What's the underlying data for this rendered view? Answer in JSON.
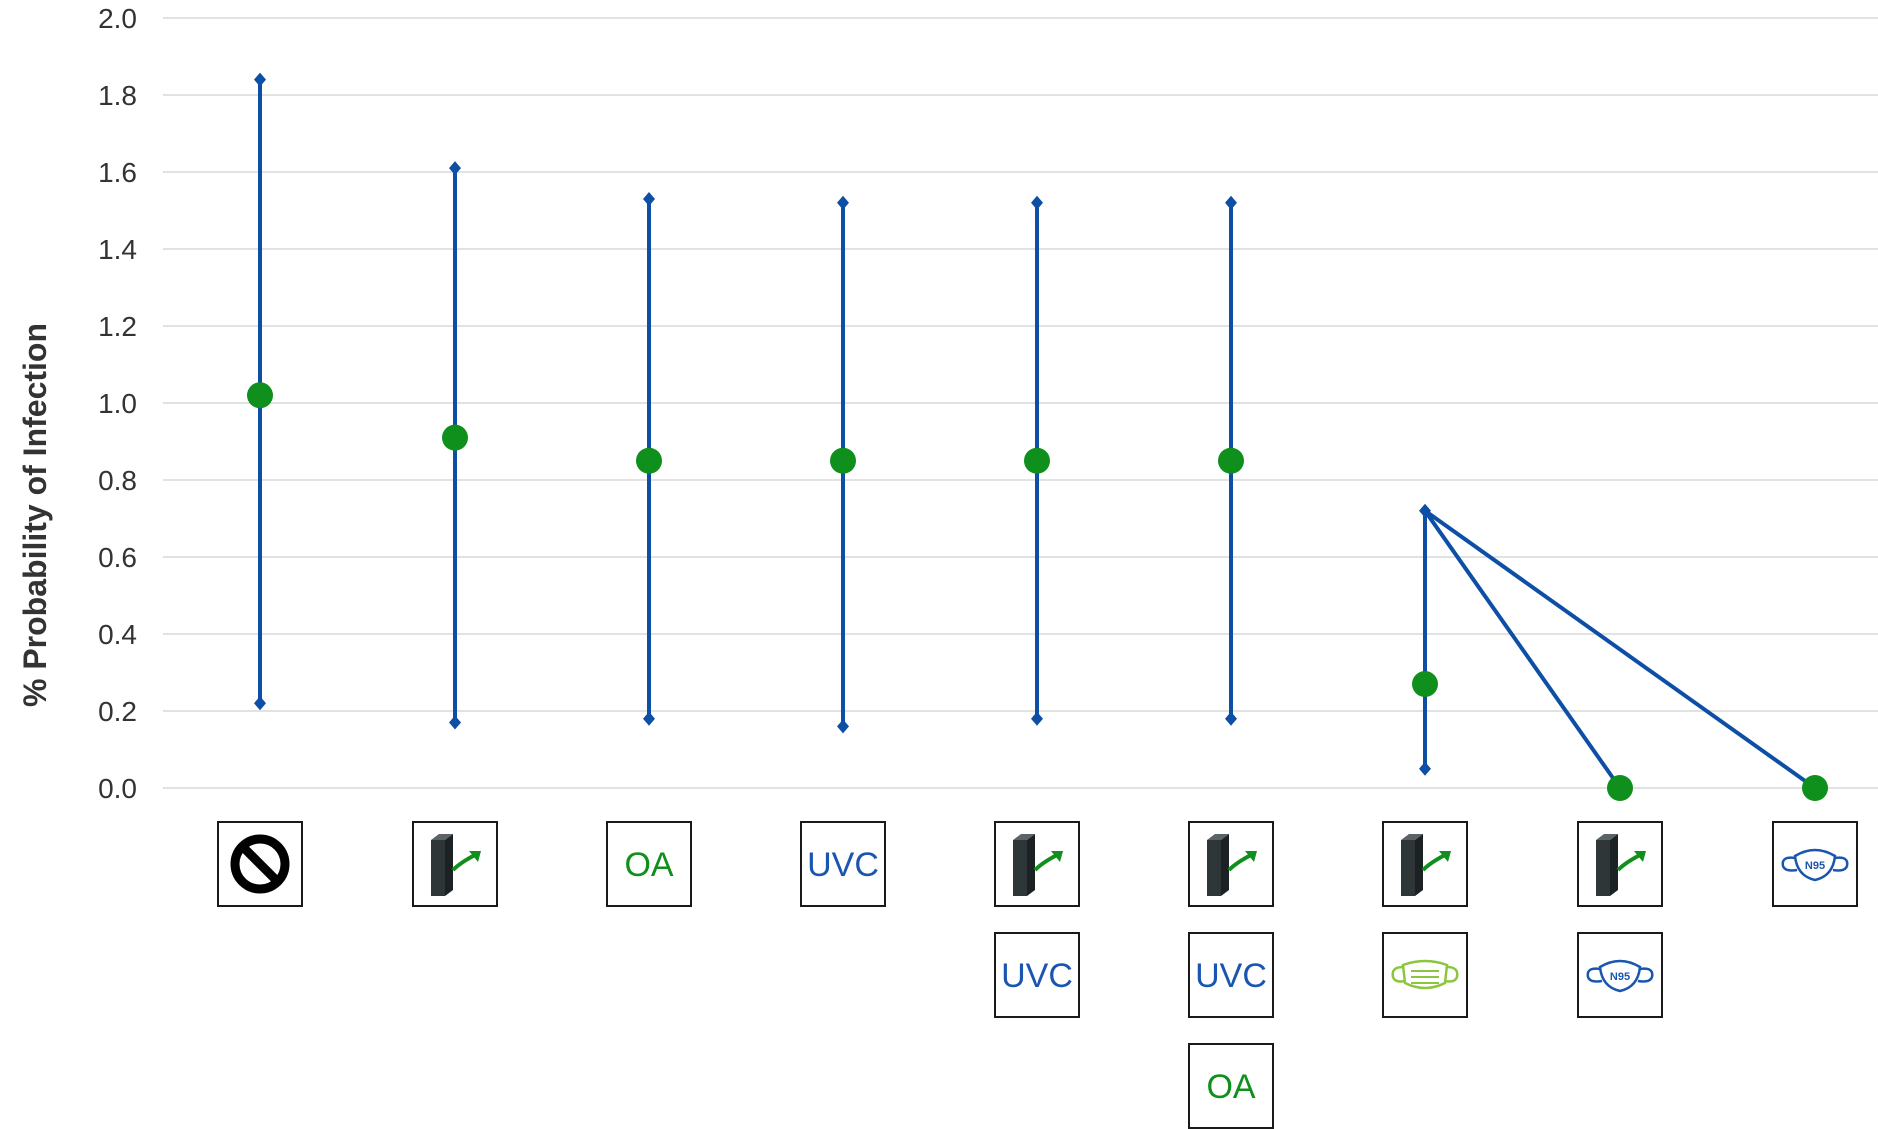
{
  "chart_data": {
    "type": "scatter",
    "title": "",
    "ylabel": "% Probability of Infection",
    "xlabel": "",
    "ylim": [
      0,
      2.0
    ],
    "y_ticks": [
      "2.0",
      "1.8",
      "1.6",
      "1.4",
      "1.2",
      "1.0",
      "0.8",
      "0.6",
      "0.4",
      "0.2",
      "0.0"
    ],
    "grid": true,
    "points": [
      {
        "y": 1.02,
        "low": 0.22,
        "high": 1.84,
        "icons": [
          "no-intervention-icon"
        ]
      },
      {
        "y": 0.91,
        "low": 0.17,
        "high": 1.61,
        "icons": [
          "ventilation-filter-icon"
        ]
      },
      {
        "y": 0.85,
        "low": 0.18,
        "high": 1.53,
        "icons": [
          "OA"
        ]
      },
      {
        "y": 0.85,
        "low": 0.16,
        "high": 1.52,
        "icons": [
          "UVC"
        ]
      },
      {
        "y": 0.85,
        "low": 0.18,
        "high": 1.52,
        "icons": [
          "ventilation-filter-icon",
          "UVC"
        ]
      },
      {
        "y": 0.85,
        "low": 0.18,
        "high": 1.52,
        "icons": [
          "ventilation-filter-icon",
          "UVC",
          "OA"
        ]
      },
      {
        "y": 0.27,
        "low": 0.05,
        "high": 0.72,
        "icons": [
          "ventilation-filter-icon",
          "surgical-mask-icon"
        ]
      },
      {
        "y": 0.0,
        "low": null,
        "high": 0.72,
        "icons": [
          "ventilation-filter-icon",
          "n95-mask-icon"
        ]
      },
      {
        "y": 0.0,
        "low": null,
        "high": 0.72,
        "icons": [
          "n95-mask-icon"
        ]
      }
    ],
    "colors": {
      "error_bar": "#0e4fa6",
      "marker": "#0f8f1c",
      "grid": "#d9d9d9",
      "uvc_text": "#1a56b0",
      "oa_text": "#0f8f1c",
      "surgical_mask": "#8cc63f"
    },
    "labels": {
      "oa": "OA",
      "uvc": "UVC",
      "n95": "N95"
    }
  }
}
